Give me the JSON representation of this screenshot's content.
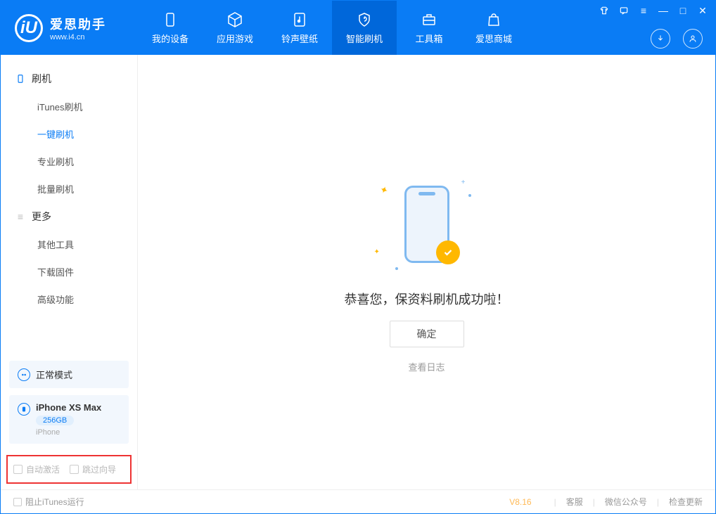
{
  "app": {
    "title": "爱思助手",
    "url": "www.i4.cn",
    "logo_letter": "iU"
  },
  "header_tabs": [
    {
      "label": "我的设备",
      "icon": "device"
    },
    {
      "label": "应用游戏",
      "icon": "cube"
    },
    {
      "label": "铃声壁纸",
      "icon": "music"
    },
    {
      "label": "智能刷机",
      "icon": "shield",
      "active": true
    },
    {
      "label": "工具箱",
      "icon": "toolbox"
    },
    {
      "label": "爱思商城",
      "icon": "bag"
    }
  ],
  "sidebar": {
    "group_flash": {
      "label": "刷机"
    },
    "items_flash": [
      {
        "label": "iTunes刷机"
      },
      {
        "label": "一键刷机",
        "active": true
      },
      {
        "label": "专业刷机"
      },
      {
        "label": "批量刷机"
      }
    ],
    "group_more": {
      "label": "更多"
    },
    "items_more": [
      {
        "label": "其他工具"
      },
      {
        "label": "下载固件"
      },
      {
        "label": "高级功能"
      }
    ],
    "mode": {
      "label": "正常模式"
    },
    "device": {
      "name": "iPhone XS Max",
      "capacity": "256GB",
      "type": "iPhone"
    },
    "opt_auto_activate": "自动激活",
    "opt_skip_guide": "跳过向导"
  },
  "main": {
    "success_text": "恭喜您，保资料刷机成功啦！",
    "ok_button": "确定",
    "view_log": "查看日志"
  },
  "footer": {
    "block_itunes": "阻止iTunes运行",
    "version": "V8.16",
    "link_support": "客服",
    "link_wechat": "微信公众号",
    "link_update": "检查更新"
  }
}
